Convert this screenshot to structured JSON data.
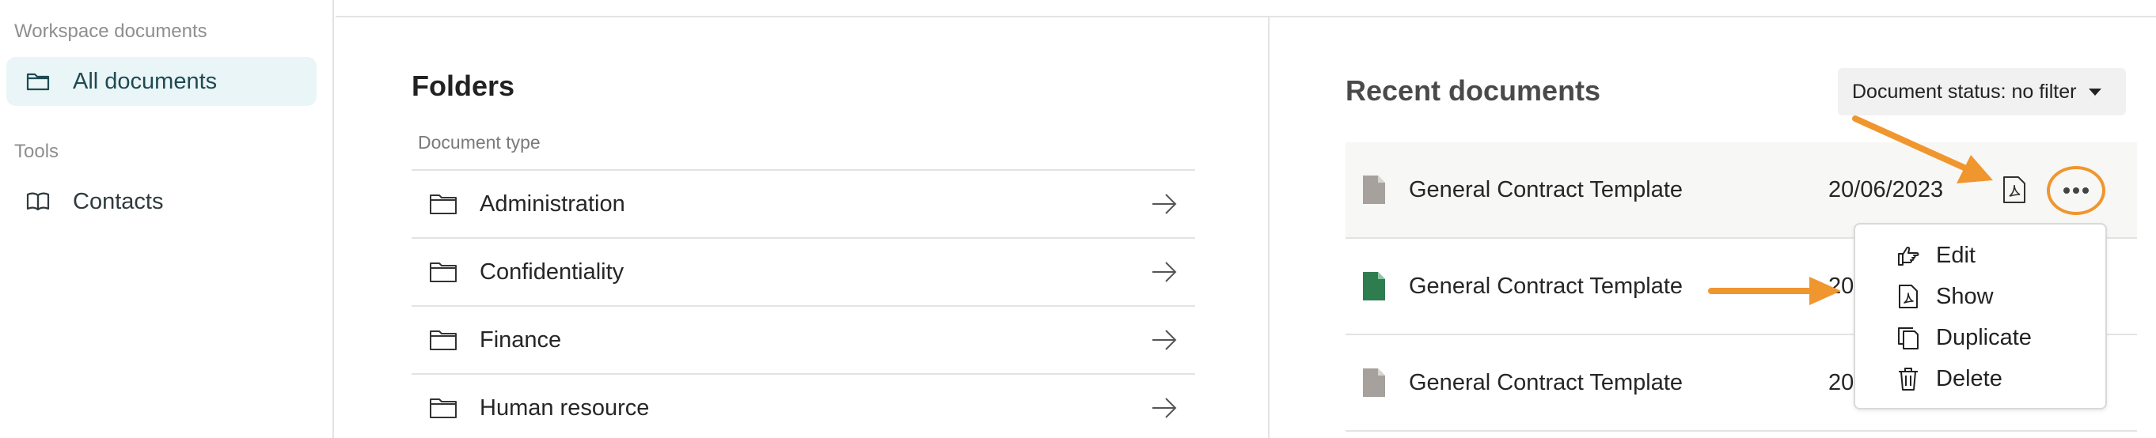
{
  "sidebar": {
    "section_workspace": "Workspace documents",
    "all_documents": "All documents",
    "section_tools": "Tools",
    "contacts": "Contacts"
  },
  "folders": {
    "title": "Folders",
    "doc_type_label": "Document type",
    "items": [
      {
        "label": "Administration"
      },
      {
        "label": "Confidentiality"
      },
      {
        "label": "Finance"
      },
      {
        "label": "Human resource"
      }
    ]
  },
  "recent": {
    "title": "Recent documents",
    "status_filter": "Document status: no filter",
    "rows": [
      {
        "name": "General Contract Template",
        "date": "20/06/2023",
        "icon_color": "#a6a19c"
      },
      {
        "name": "General Contract Template",
        "date": "20",
        "icon_color": "#2e7d4f"
      },
      {
        "name": "General Contract Template",
        "date": "20",
        "icon_color": "#a6a19c"
      }
    ]
  },
  "menu": {
    "items": [
      {
        "label": "Edit",
        "icon": "hand-pointing-icon"
      },
      {
        "label": "Show",
        "icon": "pdf-icon"
      },
      {
        "label": "Duplicate",
        "icon": "copy-icon"
      },
      {
        "label": "Delete",
        "icon": "trash-icon"
      }
    ]
  },
  "colors": {
    "accent": "#f0962f",
    "active_bg": "#eaf5f7"
  }
}
